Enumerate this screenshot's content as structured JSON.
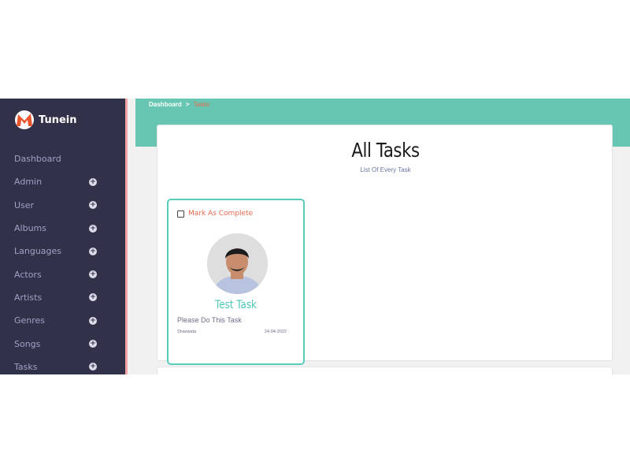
{
  "app": {
    "brand_name": "Tunein"
  },
  "sidebar": {
    "items": [
      {
        "label": "Dashboard",
        "expandable": false
      },
      {
        "label": "Admin",
        "expandable": true
      },
      {
        "label": "User",
        "expandable": true
      },
      {
        "label": "Albums",
        "expandable": true
      },
      {
        "label": "Languages",
        "expandable": true
      },
      {
        "label": "Actors",
        "expandable": true
      },
      {
        "label": "Artists",
        "expandable": true
      },
      {
        "label": "Genres",
        "expandable": true
      },
      {
        "label": "Songs",
        "expandable": true
      },
      {
        "label": "Tasks",
        "expandable": true
      }
    ]
  },
  "breadcrumb": {
    "root": "Dashboard",
    "separator": ">",
    "current": "Tasks"
  },
  "page": {
    "title": "All Tasks",
    "subtitle": "List Of Every Task"
  },
  "task": {
    "mark_label": "Mark As Complete",
    "title": "Test Task",
    "description": "Please Do This Task",
    "author": "Shaswata",
    "date": "24-04-2022"
  },
  "icons": {
    "logo": "tunein-m-logo",
    "expand": "plus-circle-icon",
    "checkbox": "checkbox-icon",
    "avatar": "user-avatar"
  },
  "colors": {
    "sidebar": "#31324a",
    "accent_teal": "#66c6b2",
    "accent_red": "#e8694f",
    "card_border": "#58ccbb"
  }
}
